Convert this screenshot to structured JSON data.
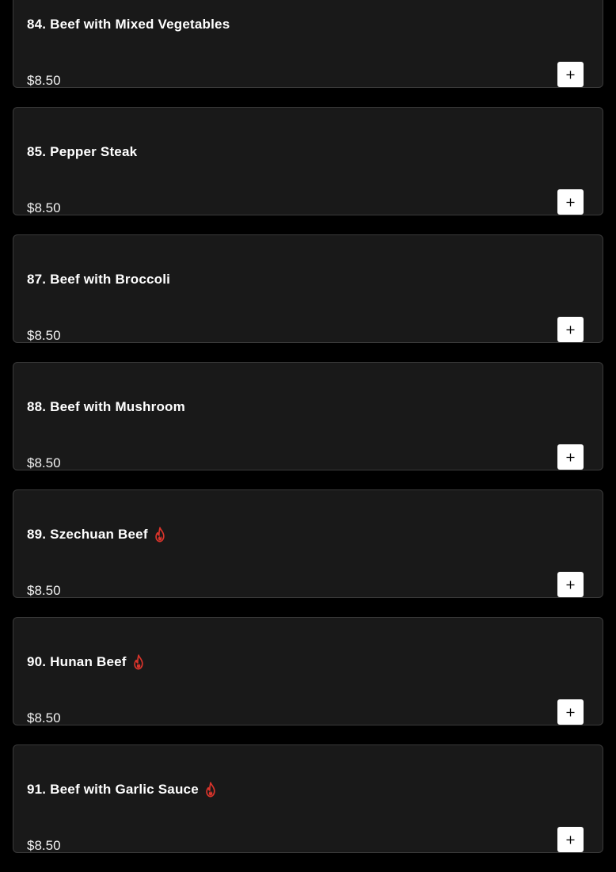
{
  "colors": {
    "page_background": "#000000",
    "card_background": "#191919",
    "card_border": "#3a3a3a",
    "text": "#ffffff",
    "spicy_icon": "#d9342b",
    "add_button_background": "#ffffff",
    "add_button_icon": "#000000"
  },
  "menu": {
    "items": [
      {
        "name": "84. Beef with Mixed Vegetables",
        "price": "$8.50",
        "spicy": false,
        "add_icon": "plus-icon"
      },
      {
        "name": "85. Pepper Steak",
        "price": "$8.50",
        "spicy": false,
        "add_icon": "plus-icon"
      },
      {
        "name": "87. Beef with Broccoli",
        "price": "$8.50",
        "spicy": false,
        "add_icon": "plus-icon"
      },
      {
        "name": "88. Beef with Mushroom",
        "price": "$8.50",
        "spicy": false,
        "add_icon": "plus-icon"
      },
      {
        "name": "89. Szechuan Beef",
        "price": "$8.50",
        "spicy": true,
        "spicy_icon": "flame-icon",
        "add_icon": "plus-icon"
      },
      {
        "name": "90. Hunan Beef",
        "price": "$8.50",
        "spicy": true,
        "spicy_icon": "flame-icon",
        "add_icon": "plus-icon"
      },
      {
        "name": "91. Beef with Garlic Sauce",
        "price": "$8.50",
        "spicy": true,
        "spicy_icon": "flame-icon",
        "add_icon": "plus-icon"
      }
    ]
  }
}
